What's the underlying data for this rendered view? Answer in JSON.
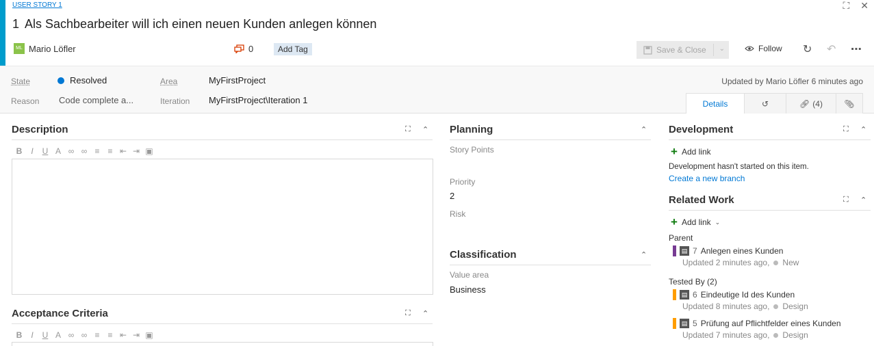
{
  "header": {
    "type_link": "USER STORY 1",
    "id": "1",
    "title": "Als Sachbearbeiter will ich einen neuen Kunden anlegen können",
    "avatar_initials": "ML",
    "owner": "Mario Löfler",
    "comment_count": "0",
    "add_tag": "Add Tag",
    "save_close": "Save & Close",
    "follow": "Follow"
  },
  "info": {
    "state_label": "State",
    "state_value": "Resolved",
    "reason_label": "Reason",
    "reason_value": "Code complete a...",
    "area_label": "Area",
    "area_value": "MyFirstProject",
    "iteration_label": "Iteration",
    "iteration_value": "MyFirstProject\\Iteration 1",
    "updated": "Updated by Mario Löfler 6 minutes ago",
    "state_color": "#0078d4"
  },
  "tabs": {
    "details": "Details",
    "links": "(4)"
  },
  "description": {
    "title": "Description"
  },
  "acceptance": {
    "title": "Acceptance Criteria"
  },
  "planning": {
    "title": "Planning",
    "story_points_label": "Story Points",
    "priority_label": "Priority",
    "priority_value": "2",
    "risk_label": "Risk"
  },
  "classification": {
    "title": "Classification",
    "value_area_label": "Value area",
    "value_area_value": "Business"
  },
  "development": {
    "title": "Development",
    "add_link": "Add link",
    "message": "Development hasn't started on this item.",
    "create_branch": "Create a new branch"
  },
  "related": {
    "title": "Related Work",
    "add_link": "Add link",
    "parent_label": "Parent",
    "parent": {
      "id": "7",
      "title": "Anlegen eines Kunden",
      "updated": "Updated 2 minutes ago,",
      "state": "New",
      "color": "#773b93"
    },
    "tested_by_label": "Tested By (2)",
    "tested": [
      {
        "id": "6",
        "title": "Eindeutige Id des Kunden",
        "updated": "Updated 8 minutes ago,",
        "state": "Design",
        "color": "#ff9d00"
      },
      {
        "id": "5",
        "title": "Prüfung auf Pflichtfelder eines Kunden",
        "updated": "Updated 7 minutes ago,",
        "state": "Design",
        "color": "#ff9d00"
      }
    ]
  }
}
